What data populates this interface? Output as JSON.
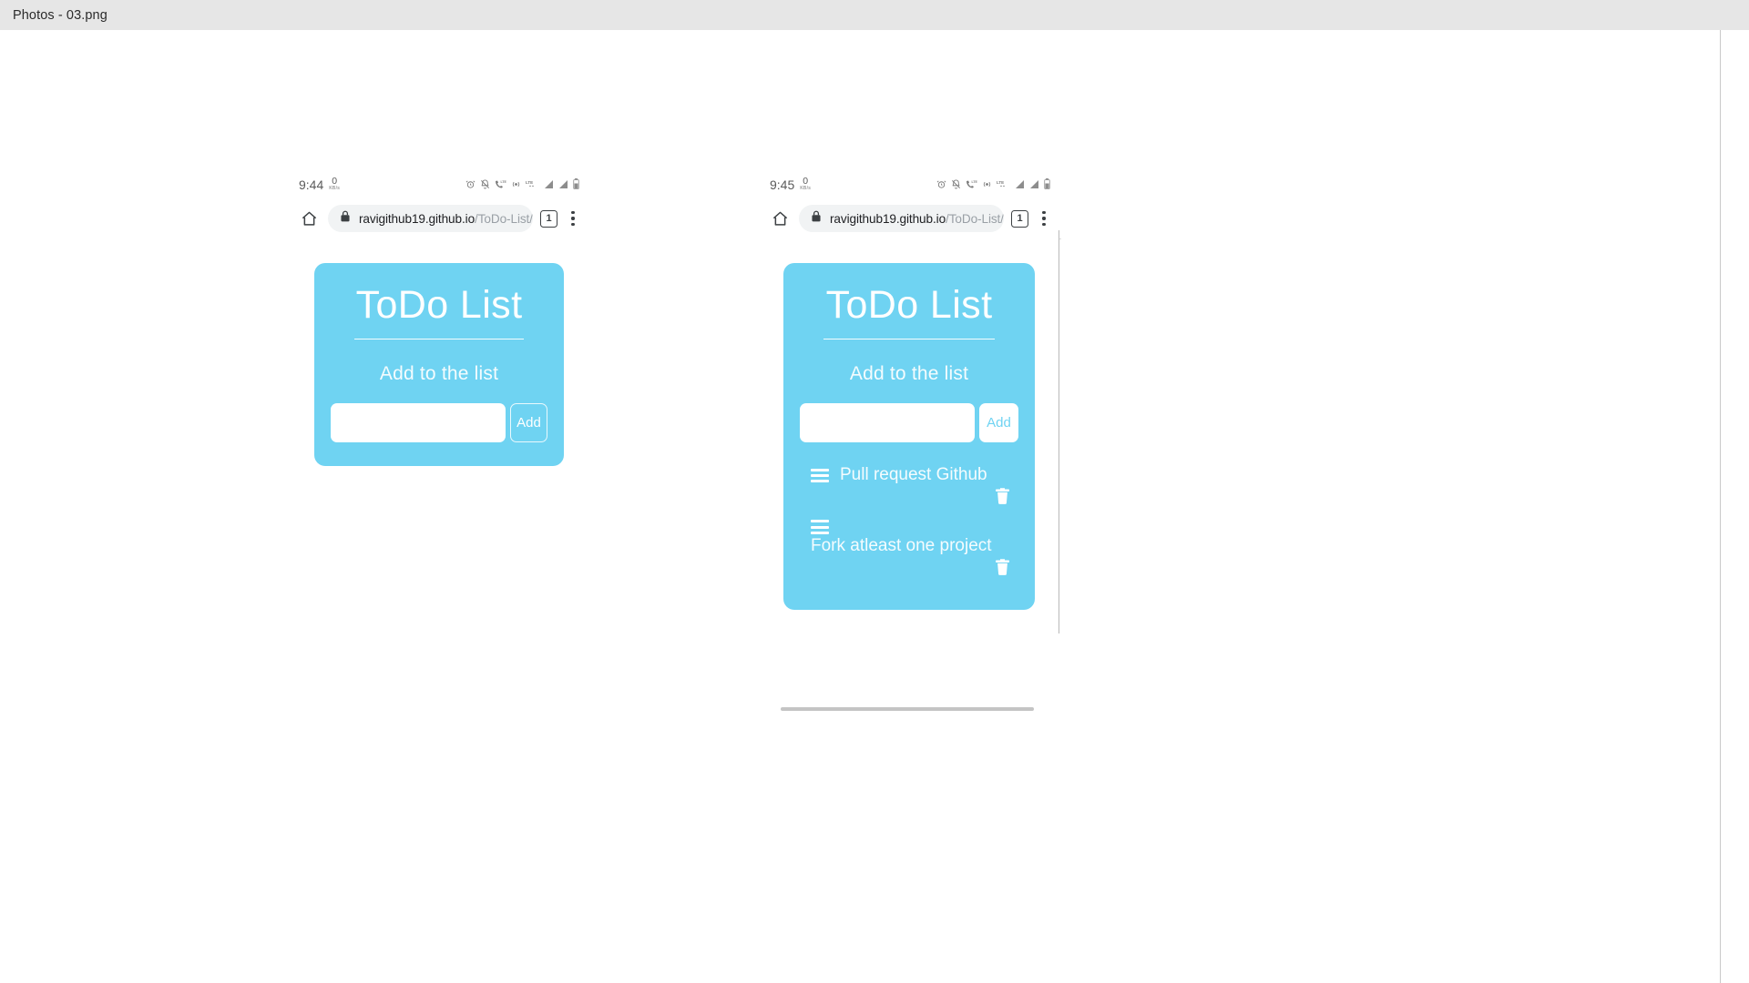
{
  "window": {
    "title": "Photos - 03.png"
  },
  "screenshots": [
    {
      "id": "a",
      "status_bar": {
        "clock": "9:44",
        "network_speed_value": "0",
        "network_speed_unit": "KB/s",
        "icons": [
          "alarm-clock-icon",
          "bell-muted-icon",
          "lte-call-icon",
          "hotspot-icon",
          "lte-label-icon",
          "signal-bars-icon",
          "signal-bars-secondary-icon",
          "battery-icon"
        ]
      },
      "browser_bar": {
        "home_icon": "home-icon",
        "lock_icon": "lock-icon",
        "url_host": "ravigithub19.github.io",
        "url_path": "/ToDo-List/",
        "tab_count": "1",
        "menu_icon": "kebab-menu-icon"
      },
      "app": {
        "title": "ToDo List",
        "subtitle": "Add to the list",
        "input_value": "",
        "input_placeholder": "",
        "add_label": "Add",
        "add_style": "ghost",
        "todos": []
      }
    },
    {
      "id": "b",
      "status_bar": {
        "clock": "9:45",
        "network_speed_value": "0",
        "network_speed_unit": "KB/s",
        "icons": [
          "alarm-clock-icon",
          "bell-muted-icon",
          "lte-call-icon",
          "hotspot-icon",
          "lte-label-icon",
          "signal-bars-icon",
          "signal-bars-secondary-icon",
          "battery-icon"
        ]
      },
      "browser_bar": {
        "home_icon": "home-icon",
        "lock_icon": "lock-icon",
        "url_host": "ravigithub19.github.io",
        "url_path": "/ToDo-List/",
        "tab_count": "1",
        "menu_icon": "kebab-menu-icon"
      },
      "app": {
        "title": "ToDo List",
        "subtitle": "Add to the list",
        "input_value": "",
        "input_placeholder": "",
        "add_label": "Add",
        "add_style": "solid",
        "todos": [
          {
            "text": "Pull request Github",
            "drag_icon": "drag-handle-icon",
            "delete_icon": "trash-icon"
          },
          {
            "text": "Fork atleast one project",
            "drag_icon": "drag-handle-icon",
            "delete_icon": "trash-icon"
          }
        ]
      }
    }
  ],
  "colors": {
    "card_blue": "#6fd3f2",
    "titlebar_bg": "#e6e6e6",
    "omnibox_bg": "#f1f3f4",
    "url_host_text": "#202124",
    "url_path_text": "#9aa0a6"
  }
}
